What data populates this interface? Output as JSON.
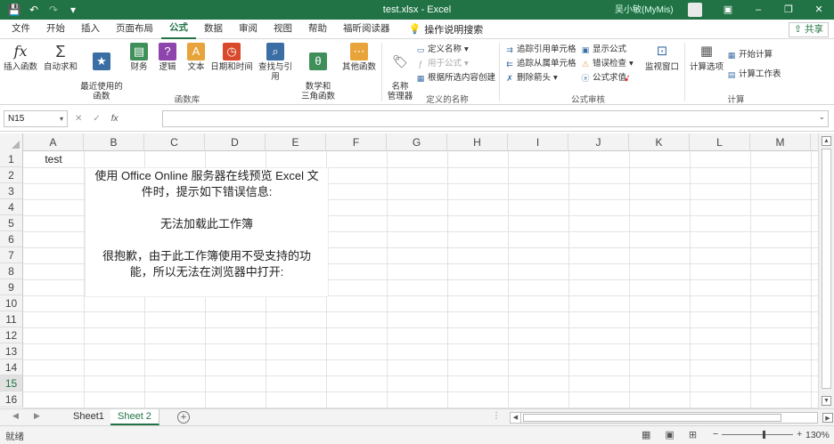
{
  "titlebar": {
    "save_icon": "save-icon",
    "undo_icon": "undo-icon",
    "redo_icon": "redo-icon",
    "customize_icon": "customize-icon",
    "title": "test.xlsx  -  Excel",
    "user": "吴小敏(MyMis)",
    "ribbon_display_icon": "ribbon-display-icon",
    "minimize": "–",
    "restore": "❐",
    "close": "✕"
  },
  "menu": {
    "tabs": [
      "文件",
      "开始",
      "插入",
      "页面布局",
      "公式",
      "数据",
      "审阅",
      "视图",
      "帮助",
      "福昕阅读器"
    ],
    "active_tab": "公式",
    "tell_me": "操作说明搜索",
    "share": "共享"
  },
  "ribbon": {
    "function_library": {
      "label": "函数库",
      "insert_function": "插入函数",
      "autosum": "自动求和",
      "recent": "最近使用的\n函数",
      "financial": "财务",
      "logical": "逻辑",
      "text": "文本",
      "datetime": "日期和时间",
      "lookup": "查找与引用",
      "math": "数学和\n三角函数",
      "more": "其他函数"
    },
    "defined_names": {
      "label": "定义的名称",
      "name_manager": "名称\n管理器",
      "define_name": "定义名称",
      "use_in_formula": "用于公式",
      "create_from_selection": "根据所选内容创建"
    },
    "formula_auditing": {
      "label": "公式审核",
      "trace_precedents": "追踪引用单元格",
      "trace_dependents": "追踪从属单元格",
      "remove_arrows": "删除箭头",
      "show_formulas": "显示公式",
      "error_checking": "错误检查",
      "evaluate_formula": "公式求值",
      "watch_window": "监视窗口"
    },
    "calculation": {
      "label": "计算",
      "calc_options": "计算选项",
      "calc_now": "开始计算",
      "calc_sheet": "计算工作表"
    }
  },
  "formula_bar": {
    "name_box": "N15",
    "cancel": "✕",
    "enter": "✓",
    "fx": "fx",
    "value": ""
  },
  "grid": {
    "columns": [
      "A",
      "B",
      "C",
      "D",
      "E",
      "F",
      "G",
      "H",
      "I",
      "J",
      "K",
      "L",
      "M"
    ],
    "rows": [
      "1",
      "2",
      "3",
      "4",
      "5",
      "6",
      "7",
      "8",
      "9",
      "10",
      "11",
      "12",
      "13",
      "14",
      "15",
      "16"
    ],
    "selected_row": "15",
    "cell_A1": "test",
    "merged_text": [
      "使用 Office Online 服务器在线预览 Excel 文",
      "件时，提示如下错误信息:",
      "",
      "无法加载此工作簿",
      "",
      "很抱歉，由于此工作簿使用不受支持的功",
      "能，所以无法在浏览器中打开:"
    ]
  },
  "sheets": {
    "tabs": [
      "Sheet1",
      "Sheet 2"
    ],
    "active": "Sheet 2",
    "add": "+"
  },
  "status": {
    "ready": "就绪",
    "zoom": "130%"
  }
}
